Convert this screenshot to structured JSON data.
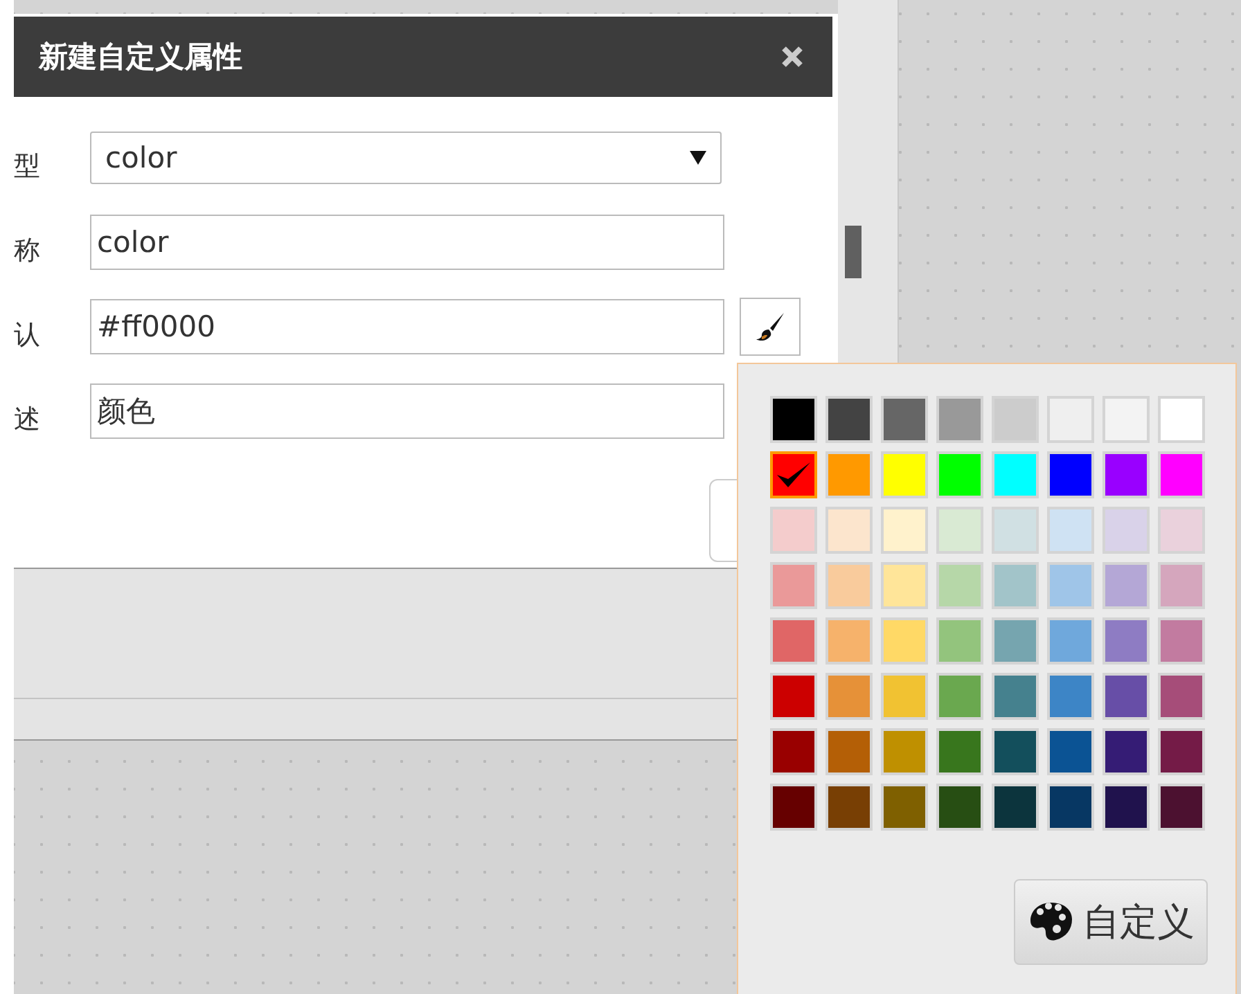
{
  "dialog": {
    "title": "新建自定义属性",
    "fields": [
      {
        "kind": "select",
        "label": "型",
        "value": "color"
      },
      {
        "kind": "text",
        "label": "称",
        "value": "color"
      },
      {
        "kind": "color",
        "label": "认",
        "value": "#ff0000"
      },
      {
        "kind": "text",
        "label": "述",
        "value": "颜色"
      }
    ]
  },
  "palette": [
    [
      {
        "color": "#000000",
        "selected": false
      },
      {
        "color": "#434343",
        "selected": false
      },
      {
        "color": "#666666",
        "selected": false
      },
      {
        "color": "#999999",
        "selected": false
      },
      {
        "color": "#cccccc",
        "selected": false
      },
      {
        "color": "#efefef",
        "selected": false
      },
      {
        "color": "#f3f3f3",
        "selected": false
      },
      {
        "color": "#ffffff",
        "selected": false
      }
    ],
    [
      {
        "color": "#ff0000",
        "selected": true
      },
      {
        "color": "#ff9900",
        "selected": false
      },
      {
        "color": "#ffff00",
        "selected": false
      },
      {
        "color": "#00ff00",
        "selected": false
      },
      {
        "color": "#00ffff",
        "selected": false
      },
      {
        "color": "#0000ff",
        "selected": false
      },
      {
        "color": "#9900ff",
        "selected": false
      },
      {
        "color": "#ff00ff",
        "selected": false
      }
    ],
    [
      {
        "color": "#f4cccc",
        "selected": false
      },
      {
        "color": "#fce5cd",
        "selected": false
      },
      {
        "color": "#fff2cc",
        "selected": false
      },
      {
        "color": "#d9ead3",
        "selected": false
      },
      {
        "color": "#d0e0e3",
        "selected": false
      },
      {
        "color": "#cfe2f3",
        "selected": false
      },
      {
        "color": "#d9d2e9",
        "selected": false
      },
      {
        "color": "#ead1dc",
        "selected": false
      }
    ],
    [
      {
        "color": "#ea9999",
        "selected": false
      },
      {
        "color": "#f9cb9c",
        "selected": false
      },
      {
        "color": "#ffe599",
        "selected": false
      },
      {
        "color": "#b6d7a8",
        "selected": false
      },
      {
        "color": "#a2c4c9",
        "selected": false
      },
      {
        "color": "#9fc5e8",
        "selected": false
      },
      {
        "color": "#b4a7d6",
        "selected": false
      },
      {
        "color": "#d5a6bd",
        "selected": false
      }
    ],
    [
      {
        "color": "#e06666",
        "selected": false
      },
      {
        "color": "#f6b26b",
        "selected": false
      },
      {
        "color": "#ffd966",
        "selected": false
      },
      {
        "color": "#93c47d",
        "selected": false
      },
      {
        "color": "#76a5af",
        "selected": false
      },
      {
        "color": "#6fa8dc",
        "selected": false
      },
      {
        "color": "#8e7cc3",
        "selected": false
      },
      {
        "color": "#c27ba0",
        "selected": false
      }
    ],
    [
      {
        "color": "#cc0000",
        "selected": false
      },
      {
        "color": "#e69138",
        "selected": false
      },
      {
        "color": "#f1c232",
        "selected": false
      },
      {
        "color": "#6aa84f",
        "selected": false
      },
      {
        "color": "#45818e",
        "selected": false
      },
      {
        "color": "#3d85c6",
        "selected": false
      },
      {
        "color": "#674ea7",
        "selected": false
      },
      {
        "color": "#a64d79",
        "selected": false
      }
    ],
    [
      {
        "color": "#990000",
        "selected": false
      },
      {
        "color": "#b45f06",
        "selected": false
      },
      {
        "color": "#bf9000",
        "selected": false
      },
      {
        "color": "#38761d",
        "selected": false
      },
      {
        "color": "#134f5c",
        "selected": false
      },
      {
        "color": "#0b5394",
        "selected": false
      },
      {
        "color": "#351c75",
        "selected": false
      },
      {
        "color": "#741b47",
        "selected": false
      }
    ],
    [
      {
        "color": "#660000",
        "selected": false
      },
      {
        "color": "#783f04",
        "selected": false
      },
      {
        "color": "#7f6000",
        "selected": false
      },
      {
        "color": "#274e13",
        "selected": false
      },
      {
        "color": "#0c343d",
        "selected": false
      },
      {
        "color": "#073763",
        "selected": false
      },
      {
        "color": "#20124d",
        "selected": false
      },
      {
        "color": "#4c1130",
        "selected": false
      }
    ]
  ],
  "custom_button": {
    "label": "自定义"
  }
}
